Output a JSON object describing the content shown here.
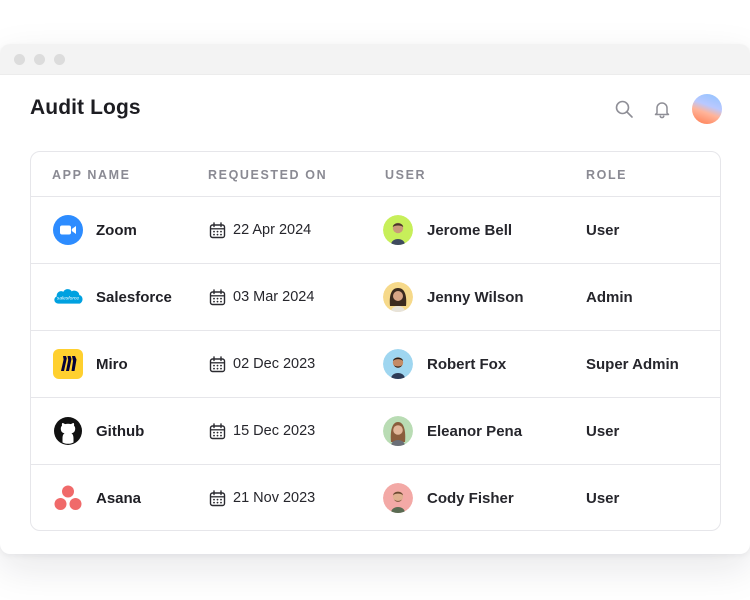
{
  "page": {
    "title": "Audit Logs"
  },
  "header": {
    "icons": [
      "search-icon",
      "bell-icon",
      "user-avatar"
    ]
  },
  "table": {
    "columns": [
      "APP NAME",
      "REQUESTED ON",
      "USER",
      "ROLE"
    ],
    "rows": [
      {
        "app": "Zoom",
        "app_icon": "zoom-icon",
        "date": "22 Apr 2024",
        "user": "Jerome Bell",
        "avatar_bg": "#c7ef5a",
        "role": "User"
      },
      {
        "app": "Salesforce",
        "app_icon": "salesforce-icon",
        "date": "03 Mar 2024",
        "user": "Jenny Wilson",
        "avatar_bg": "#f6d98a",
        "role": "Admin"
      },
      {
        "app": "Miro",
        "app_icon": "miro-icon",
        "date": "02 Dec 2023",
        "user": "Robert Fox",
        "avatar_bg": "#9fd6f0",
        "role": "Super Admin"
      },
      {
        "app": "Github",
        "app_icon": "github-icon",
        "date": "15 Dec 2023",
        "user": "Eleanor Pena",
        "avatar_bg": "#b9dcb4",
        "role": "User"
      },
      {
        "app": "Asana",
        "app_icon": "asana-icon",
        "date": "21 Nov 2023",
        "user": "Cody Fisher",
        "avatar_bg": "#f3a9a6",
        "role": "User"
      }
    ]
  },
  "colors": {
    "zoom": "#2d8cff",
    "salesforce": "#00a1e0",
    "miro": "#ffd02f",
    "github": "#111111",
    "asana": "#f06a6a"
  }
}
